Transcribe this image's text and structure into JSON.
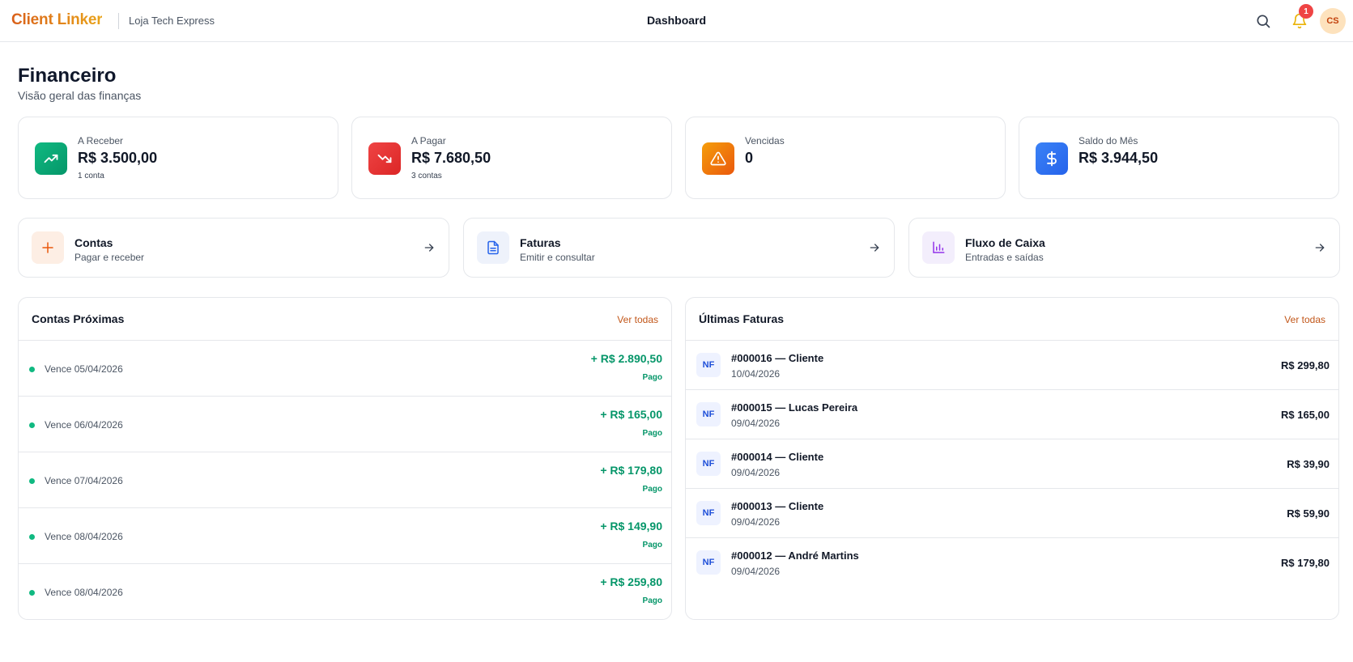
{
  "header": {
    "brand": "Client Linker",
    "store": "Loja Tech Express",
    "title": "Dashboard",
    "notification_count": "1",
    "avatar_initials": "CS"
  },
  "page": {
    "title": "Financeiro",
    "subtitle": "Visão geral das finanças"
  },
  "stats": [
    {
      "label": "A Receber",
      "value": "R$ 3.500,00",
      "sub": "1 conta",
      "icon": "trending-up-icon",
      "color": "#10b981"
    },
    {
      "label": "A Pagar",
      "value": "R$ 7.680,50",
      "sub": "3 contas",
      "icon": "trending-down-icon",
      "color": "#ef4444"
    },
    {
      "label": "Vencidas",
      "value": "0",
      "sub": "",
      "icon": "warning-icon",
      "color": "#f59e0b"
    },
    {
      "label": "Saldo do Mês",
      "value": "R$ 3.944,50",
      "sub": "",
      "icon": "dollar-icon",
      "color": "#3b82f6"
    }
  ],
  "shortcuts": [
    {
      "title": "Contas",
      "sub": "Pagar e receber",
      "icon": "plus-icon",
      "color": "#ea580c"
    },
    {
      "title": "Faturas",
      "sub": "Emitir e consultar",
      "icon": "document-icon",
      "color": "#2563eb"
    },
    {
      "title": "Fluxo de Caixa",
      "sub": "Entradas e saídas",
      "icon": "bar-chart-icon",
      "color": "#9333ea"
    }
  ],
  "accounts_panel": {
    "title": "Contas Próximas",
    "link": "Ver todas",
    "items": [
      {
        "date": "Vence 05/04/2026",
        "amount": "+ R$ 2.890,50",
        "status": "Pago"
      },
      {
        "date": "Vence 06/04/2026",
        "amount": "+ R$ 165,00",
        "status": "Pago"
      },
      {
        "date": "Vence 07/04/2026",
        "amount": "+ R$ 179,80",
        "status": "Pago"
      },
      {
        "date": "Vence 08/04/2026",
        "amount": "+ R$ 149,90",
        "status": "Pago"
      },
      {
        "date": "Vence 08/04/2026",
        "amount": "+ R$ 259,80",
        "status": "Pago"
      }
    ]
  },
  "invoices_panel": {
    "title": "Últimas Faturas",
    "link": "Ver todas",
    "badge": "NF",
    "items": [
      {
        "title": "#000016 — Cliente",
        "date": "10/04/2026",
        "amount": "R$ 299,80"
      },
      {
        "title": "#000015 — Lucas Pereira",
        "date": "09/04/2026",
        "amount": "R$ 165,00"
      },
      {
        "title": "#000014 — Cliente",
        "date": "09/04/2026",
        "amount": "R$ 39,90"
      },
      {
        "title": "#000013 — Cliente",
        "date": "09/04/2026",
        "amount": "R$ 59,90"
      },
      {
        "title": "#000012 — André Martins",
        "date": "09/04/2026",
        "amount": "R$ 179,80"
      }
    ]
  }
}
